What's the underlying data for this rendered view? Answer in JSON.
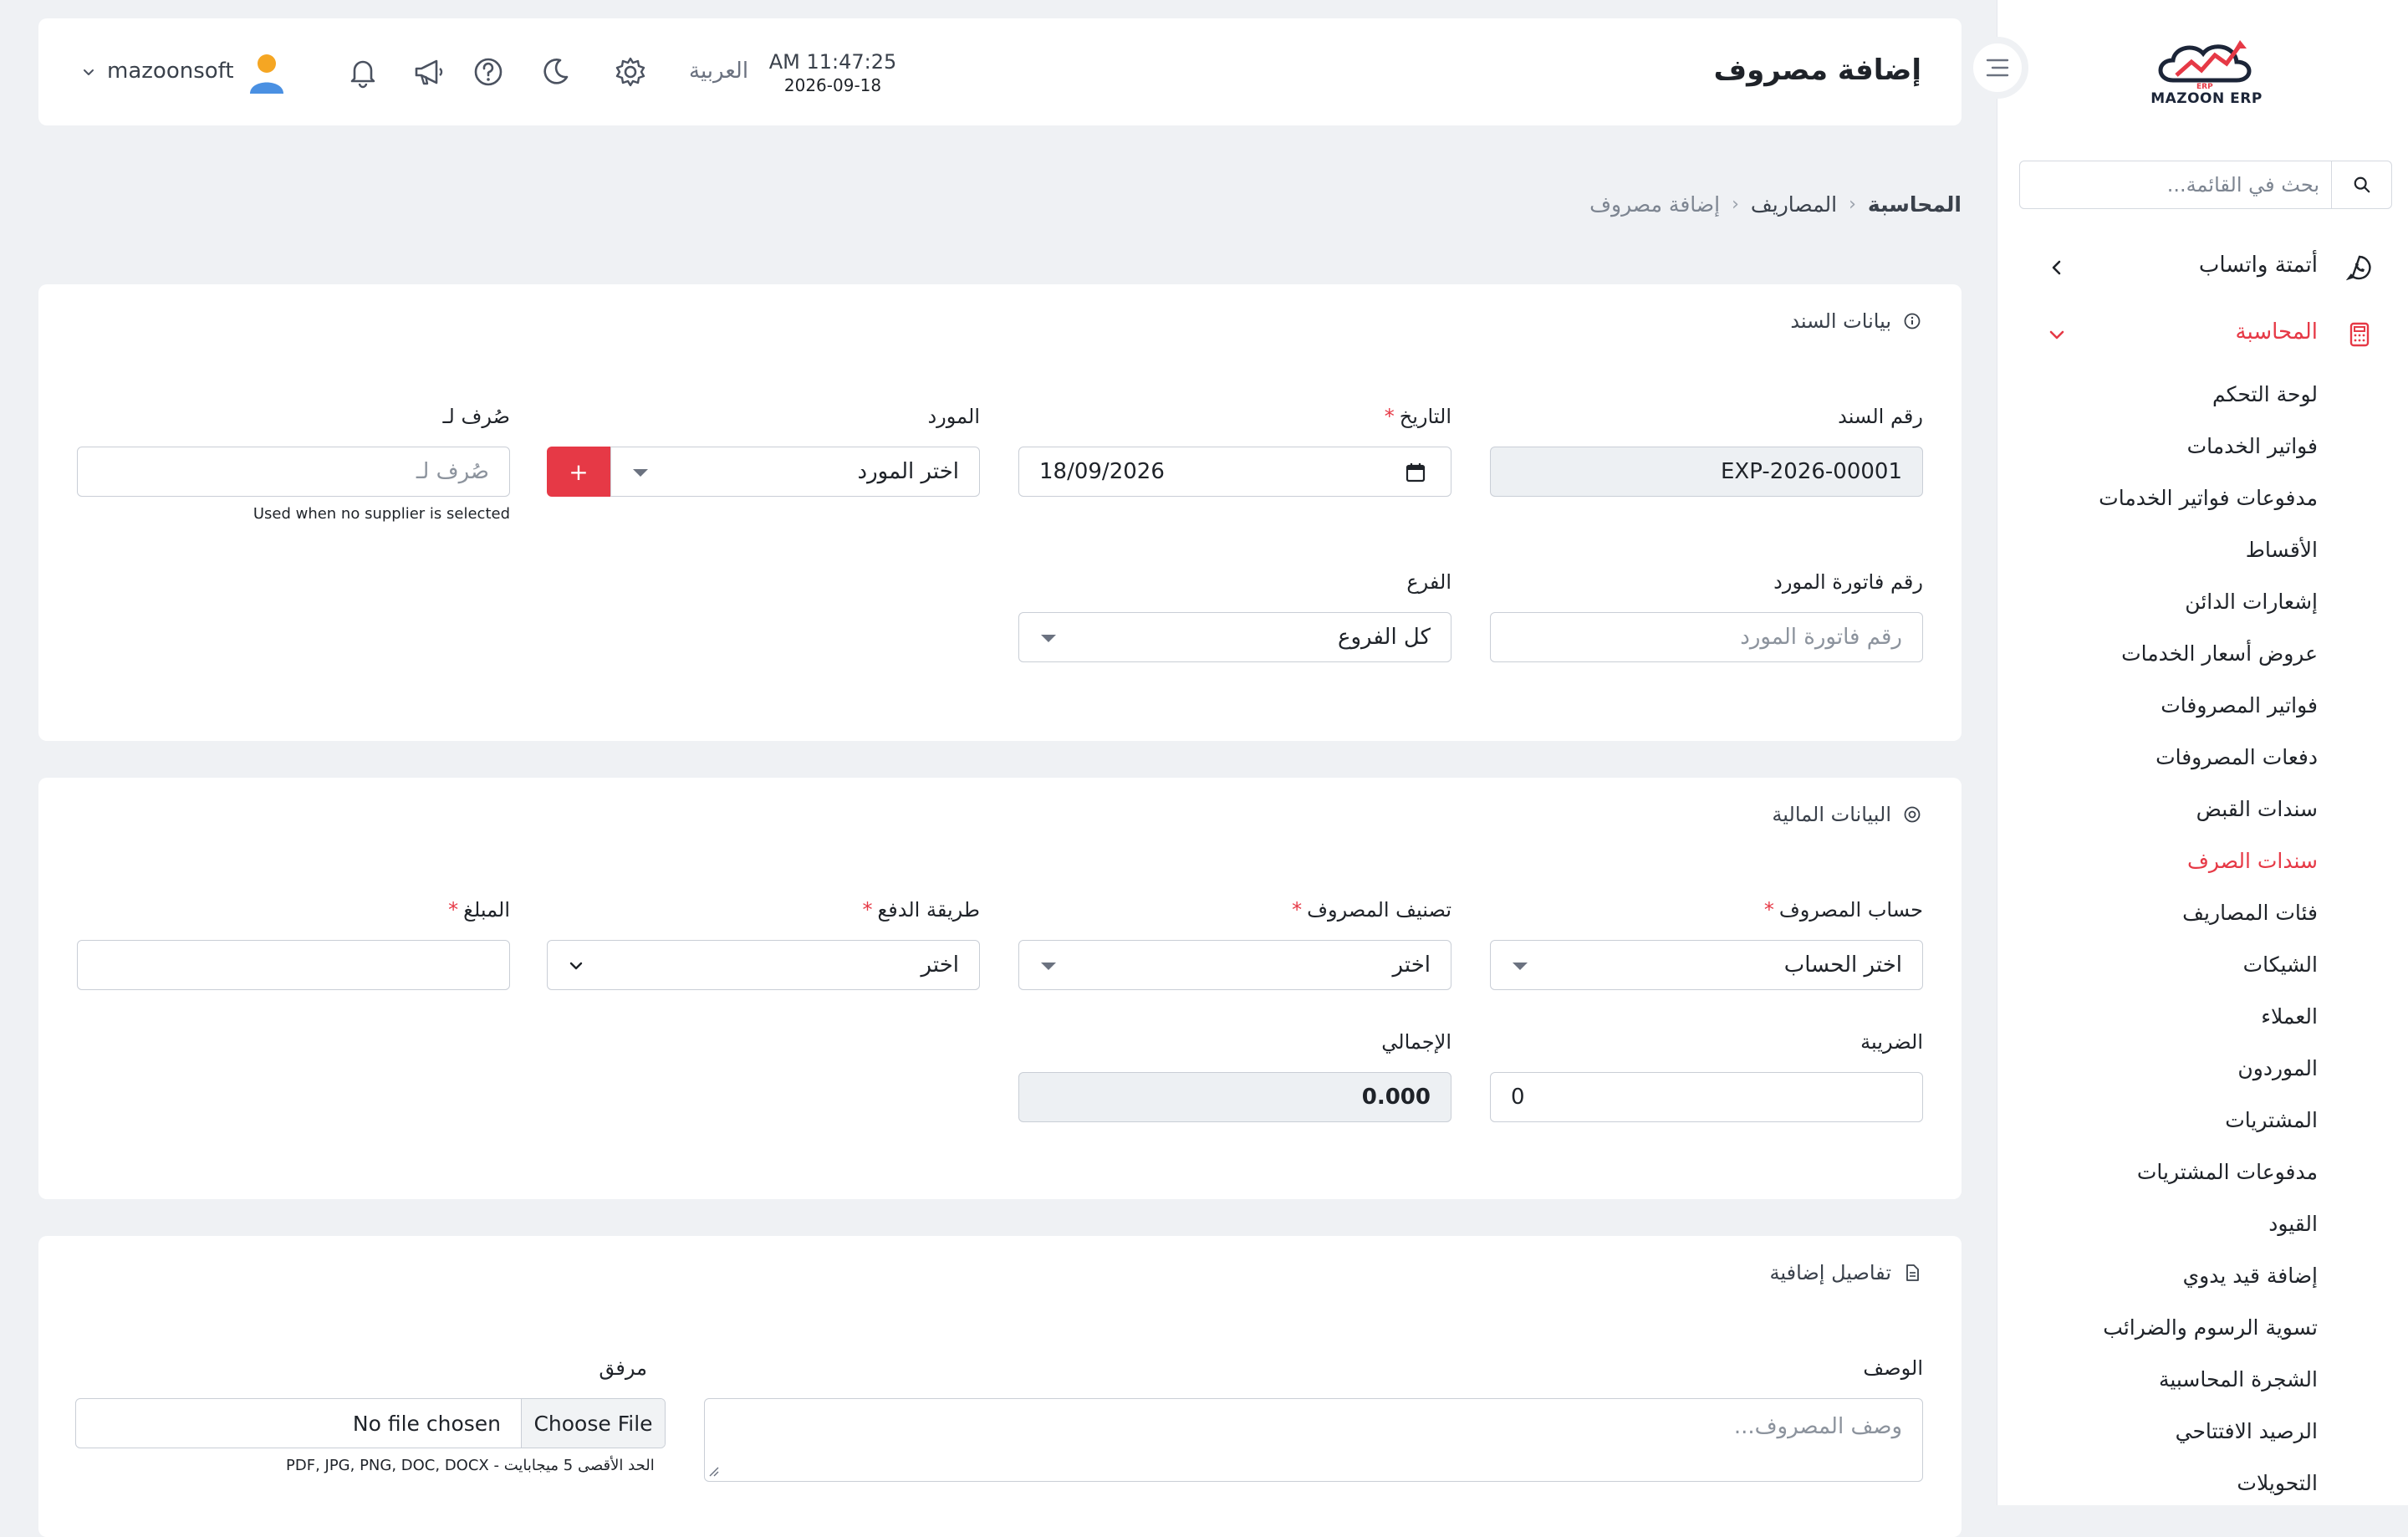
{
  "brand": {
    "name": "MAZOON ERP",
    "sub": "ERP"
  },
  "sidebar": {
    "search_placeholder": "بحث في القائمة...",
    "menu": [
      {
        "label": "أتمتة واتساب",
        "icon": "whatsapp-icon"
      },
      {
        "label": "المحاسبة",
        "icon": "calculator-icon"
      }
    ],
    "sub_items": [
      "لوحة التحكم",
      "فواتير الخدمات",
      "مدفوعات فواتير الخدمات",
      "الأقساط",
      "إشعارات الدائن",
      "عروض أسعار الخدمات",
      "فواتير المصروفات",
      "دفعات المصروفات",
      "سندات القبض",
      "سندات الصرف",
      "فئات المصاريف",
      "الشيكات",
      "العملاء",
      "الموردون",
      "المشتريات",
      "مدفوعات المشتريات",
      "القيود",
      "إضافة قيد يدوي",
      "تسوية الرسوم والضرائب",
      "الشجرة المحاسبية",
      "الرصيد الافتتاحي",
      "التحويلات"
    ]
  },
  "header": {
    "title": "إضافة مصروف",
    "time": "AM 11:47:25",
    "date": "2026-09-18",
    "language": "العربية",
    "username": "mazoonsoft"
  },
  "breadcrumb": {
    "root": "المحاسبة",
    "parent": "المصاريف",
    "current": "إضافة مصروف"
  },
  "voucher": {
    "title": "بيانات السند",
    "number_label": "رقم السند",
    "number_value": "EXP-2026-00001",
    "date_label": "التاريخ",
    "date_value": "18/09/2026",
    "supplier_label": "المورد",
    "supplier_placeholder": "اختر المورد",
    "add_label": "+",
    "paid_to_label": "صُرف لـ",
    "paid_to_placeholder": "صُرف لـ",
    "paid_to_hint": "Used when no supplier is selected",
    "invoice_label": "رقم فاتورة المورد",
    "invoice_placeholder": "رقم فاتورة المورد",
    "branch_label": "الفرع",
    "branch_value": "كل الفروع"
  },
  "financial": {
    "title": "البيانات المالية",
    "account_label": "حساب المصروف",
    "account_placeholder": "اختر الحساب",
    "category_label": "تصنيف المصروف",
    "category_placeholder": "اختر",
    "method_label": "طريقة الدفع",
    "method_placeholder": "اختر",
    "amount_label": "المبلغ",
    "amount_value": "",
    "tax_label": "الضريبة",
    "tax_value": "0",
    "total_label": "الإجمالي",
    "total_value": "0.000"
  },
  "extra": {
    "title": "تفاصيل إضافية",
    "description_label": "الوصف",
    "description_placeholder": "وصف المصروف...",
    "attachment_label": "مرفق",
    "file_button": "Choose File",
    "file_status": "No file chosen",
    "file_hint": "PDF, JPG, PNG, DOC, DOCX - الحد الأقصى 5 ميجابايت"
  },
  "colors": {
    "accent": "#e63946",
    "background": "#eff1f4"
  }
}
